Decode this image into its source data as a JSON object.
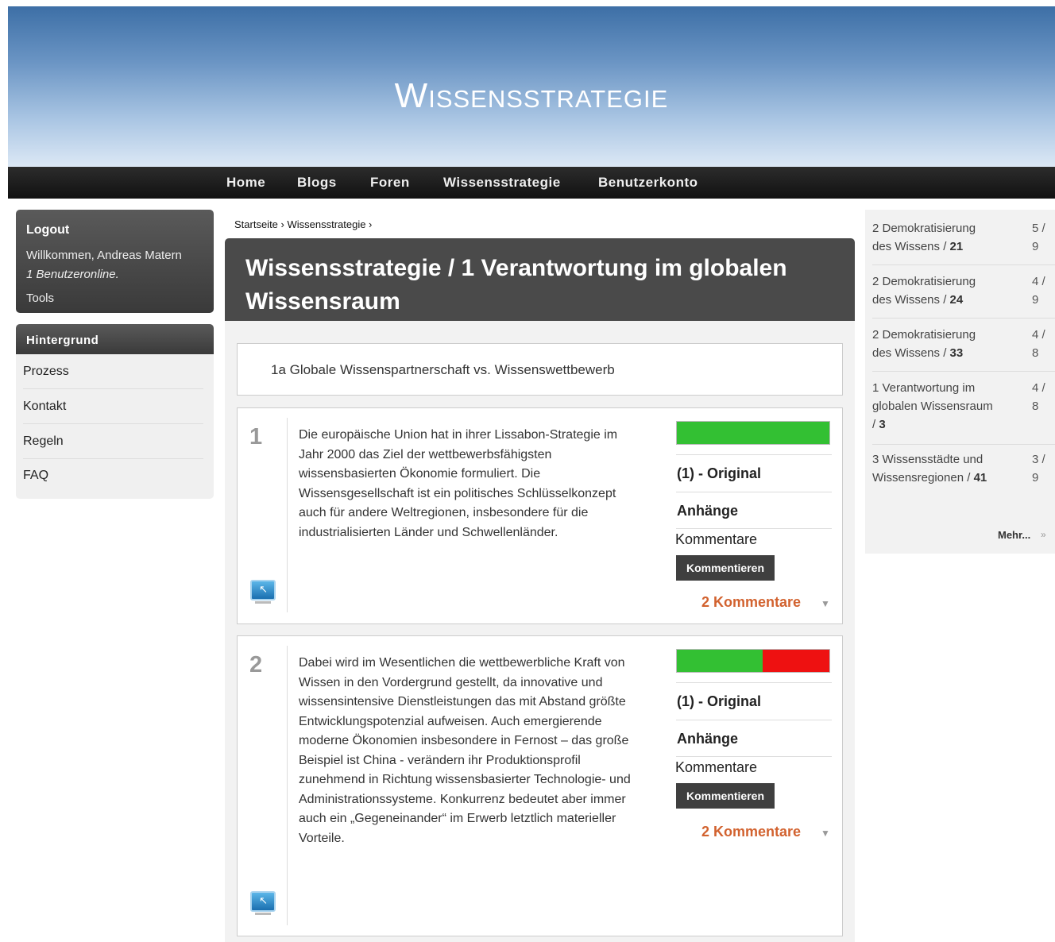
{
  "header": {
    "site_title": "Wissensstrategie"
  },
  "nav": [
    "Home",
    "Blogs",
    "Foren",
    "Wissensstrategie",
    "Benutzerkonto"
  ],
  "login": {
    "logout_label": "Logout",
    "welcome": "Willkommen, Andreas Matern",
    "online": "1 Benutzeronline.",
    "tools": "Tools"
  },
  "menu": {
    "heading": "Hintergrund",
    "items": [
      "Prozess",
      "Kontakt",
      "Regeln",
      "FAQ"
    ]
  },
  "breadcrumb": "Startseite › Wissensstrategie ›",
  "page_title": "Wissensstrategie / 1 Verantwortung im globalen Wissensraum",
  "sub_title": "1a Globale Wissenspartnerschaft vs. Wissenswettbewerb",
  "posts": [
    {
      "number": "1",
      "text": "Die europäische Union hat in ihrer Lissabon-Strategie im Jahr 2000 das Ziel der wettbewerbsfähigsten wissensbasierten Ökonomie formuliert. Die Wissensgesellschaft ist ein politisches Schlüsselkonzept auch für andere Weltregionen, insbesondere für die industrialisierten Länder und Schwellenländer.",
      "rating": {
        "green_fraction": 1.0,
        "red_fraction": 0.0
      },
      "original": "(1) - Original",
      "attachments": "Anhänge",
      "comments_label": "Kommentare",
      "comment_button": "Kommentieren",
      "comment_count": "2 Kommentare"
    },
    {
      "number": "2",
      "text": "Dabei wird im Wesentlichen die wettbewerbliche Kraft von Wissen in den Vordergrund gestellt, da innovative und wissensintensive Dienstleistungen das mit Abstand größte Entwicklungspotenzial aufweisen. Auch emergierende moderne Ökonomien insbesondere in Fernost – das große Beispiel ist China - verändern ihr Produktionsprofil zunehmend in Richtung wissensbasierter Technologie- und Administrationssysteme. Konkurrenz bedeutet aber immer auch ein „Gegeneinander“ im Erwerb letztlich materieller Vorteile.",
      "rating": {
        "green_fraction": 0.56,
        "red_fraction": 0.44
      },
      "original": "(1) - Original",
      "attachments": "Anhänge",
      "comments_label": "Kommentare",
      "comment_button": "Kommentieren",
      "comment_count": "2 Kommentare"
    }
  ],
  "right_sidebar": {
    "items": [
      {
        "title": "2 Demokratisierung des Wissens /",
        "num": "21",
        "score": "5 / 9"
      },
      {
        "title": "2 Demokratisierung des Wissens /",
        "num": "24",
        "score": "4 / 9"
      },
      {
        "title": "2 Demokratisierung des Wissens /",
        "num": "33",
        "score": "4 / 8"
      },
      {
        "title": "1 Verantwortung im globalen Wissensraum /",
        "num": "3",
        "score": "4 / 8"
      },
      {
        "title": "3 Wissensstädte und Wissensregionen /",
        "num": "41",
        "score": "3 / 9"
      }
    ],
    "more": "Mehr..."
  },
  "colors": {
    "rating_green": "#33c033",
    "rating_red": "#ee1111",
    "comment_count": "#d2622f"
  }
}
